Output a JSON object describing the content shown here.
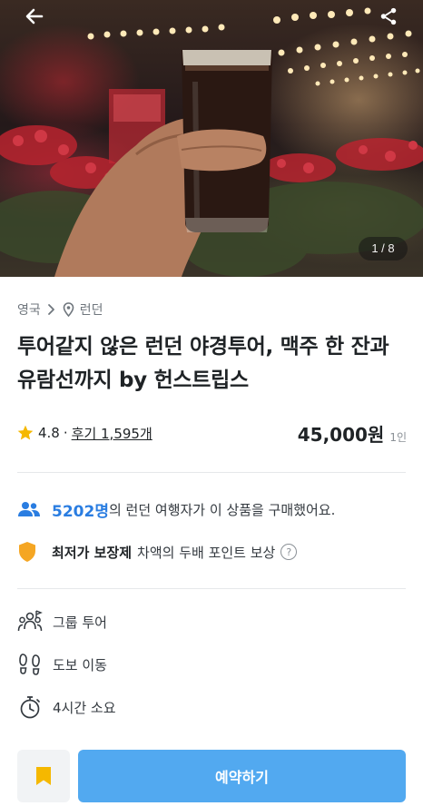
{
  "hero": {
    "image_counter": "1 / 8",
    "back_icon": "arrow-left-icon",
    "share_icon": "share-icon"
  },
  "breadcrumb": {
    "country": "영국",
    "separator_icon": "chevron-right-icon",
    "location_icon": "location-pin-icon",
    "city": "런던"
  },
  "product": {
    "title": "투어같지 않은 런던 야경투어, 맥주 한 잔과 유람선까지 by 헌스트립스",
    "rating": "4.8",
    "rating_separator": "·",
    "reviews_label": "후기 1,595개",
    "price": "45,000원",
    "price_unit": "1인"
  },
  "social_proof": {
    "count": "5202명",
    "text": "의 런던 여행자가 이 상품을 구매했어요."
  },
  "guarantee": {
    "title": "최저가 보장제",
    "text": "차액의 두배 포인트 보상",
    "help_glyph": "?"
  },
  "features": [
    {
      "icon": "group-icon",
      "label": "그룹 투어"
    },
    {
      "icon": "footprints-icon",
      "label": "도보 이동"
    },
    {
      "icon": "stopwatch-icon",
      "label": "4시간 소요"
    }
  ],
  "actions": {
    "bookmark_icon": "bookmark-icon",
    "reserve_label": "예약하기"
  },
  "colors": {
    "accent": "#2a7de1",
    "primary_button": "#52a9f0",
    "shield": "#f5a623",
    "star": "#f5b800",
    "bookmark": "#f5b800"
  }
}
